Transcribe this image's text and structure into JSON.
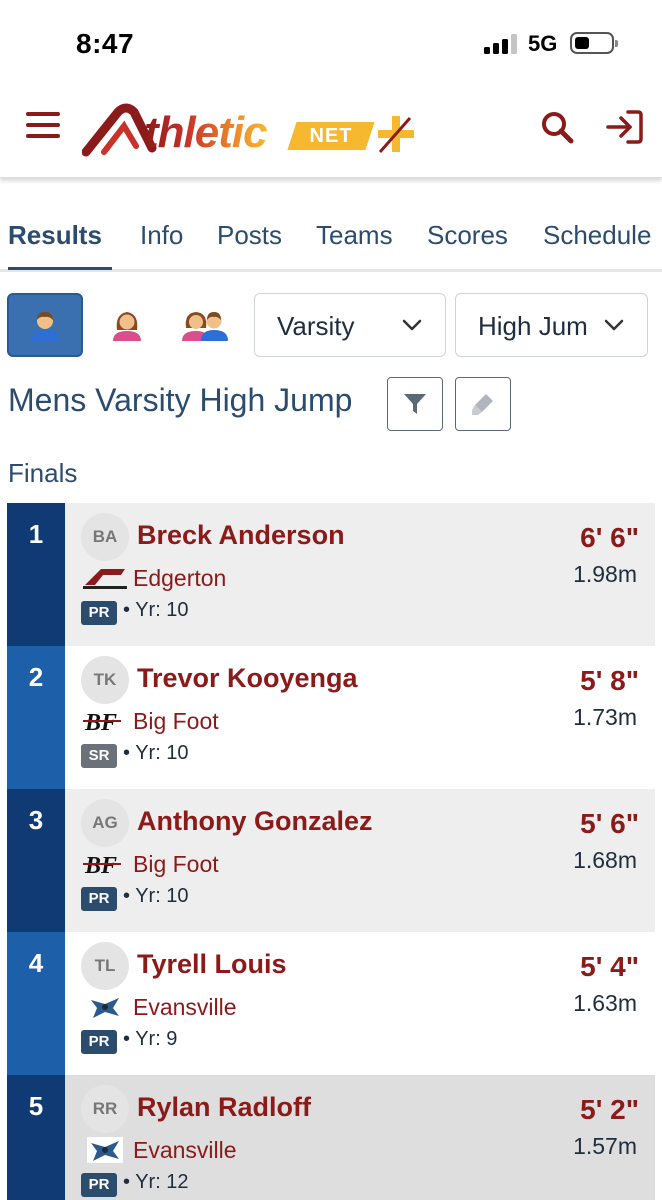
{
  "status_bar": {
    "time": "8:47",
    "network": "5G"
  },
  "header": {
    "logo_text": "thletic",
    "logo_suffix": "NET"
  },
  "tabs": [
    {
      "label": "Results",
      "active": true
    },
    {
      "label": "Info"
    },
    {
      "label": "Posts"
    },
    {
      "label": "Teams"
    },
    {
      "label": "Scores"
    },
    {
      "label": "Schedule"
    }
  ],
  "filters": {
    "gender_buttons": [
      "male-icon",
      "female-icon",
      "both-genders-icon"
    ],
    "level": "Varsity",
    "event": "High Jump"
  },
  "event_title": "Mens Varsity High Jump",
  "section_label": "Finals",
  "colors": {
    "maroon": "#8b1a1a",
    "navy": "#2c4c6e",
    "place_dark": "#0f3a73",
    "place_light": "#1d5fa8",
    "pr_badge": "#2c4c6e",
    "sr_badge": "#6b7178"
  },
  "results": [
    {
      "place": "1",
      "initials": "BA",
      "name": "Breck Anderson",
      "team": "Edgerton",
      "badge": "PR",
      "year": "• Yr: 10",
      "mark": "6' 6\"",
      "metric": "1.98m"
    },
    {
      "place": "2",
      "initials": "TK",
      "name": "Trevor Kooyenga",
      "team": "Big Foot",
      "badge": "SR",
      "year": "• Yr: 10",
      "mark": "5' 8\"",
      "metric": "1.73m"
    },
    {
      "place": "3",
      "initials": "AG",
      "name": "Anthony Gonzalez",
      "team": "Big Foot",
      "badge": "PR",
      "year": "• Yr: 10",
      "mark": "5' 6\"",
      "metric": "1.68m"
    },
    {
      "place": "4",
      "initials": "TL",
      "name": "Tyrell Louis",
      "team": "Evansville",
      "badge": "PR",
      "year": "• Yr: 9",
      "mark": "5' 4\"",
      "metric": "1.63m"
    },
    {
      "place": "5",
      "initials": "RR",
      "name": "Rylan Radloff",
      "team": "Evansville",
      "badge": "PR",
      "year": "• Yr: 12",
      "mark": "5' 2\"",
      "metric": "1.57m"
    }
  ]
}
